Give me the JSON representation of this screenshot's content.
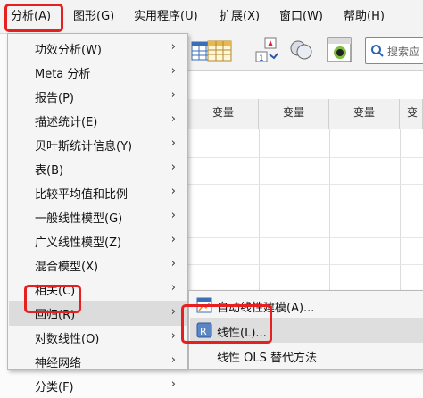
{
  "menubar": {
    "items": [
      {
        "label": "分析(A)"
      },
      {
        "label": "图形(G)"
      },
      {
        "label": "实用程序(U)"
      },
      {
        "label": "扩展(X)"
      },
      {
        "label": "窗口(W)"
      },
      {
        "label": "帮助(H)"
      }
    ]
  },
  "toolbar": {
    "search_placeholder": "搜索应"
  },
  "grid": {
    "headers": [
      "变量",
      "变量",
      "变量",
      "变量"
    ]
  },
  "analyze_menu": {
    "items": [
      {
        "label": "功效分析(W)"
      },
      {
        "label": "Meta 分析"
      },
      {
        "label": "报告(P)"
      },
      {
        "label": "描述统计(E)"
      },
      {
        "label": "贝叶斯统计信息(Y)"
      },
      {
        "label": "表(B)"
      },
      {
        "label": "比较平均值和比例"
      },
      {
        "label": "一般线性模型(G)"
      },
      {
        "label": "广义线性模型(Z)"
      },
      {
        "label": "混合模型(X)"
      },
      {
        "label": "相关(C)"
      },
      {
        "label": "回归(R)"
      },
      {
        "label": "对数线性(O)"
      },
      {
        "label": "神经网络"
      },
      {
        "label": "分类(F)"
      }
    ],
    "arrow": "›"
  },
  "regression_submenu": {
    "items": [
      {
        "label": "自动线性建模(A)..."
      },
      {
        "label": "线性(L)..."
      },
      {
        "label": "线性 OLS 替代方法"
      }
    ]
  },
  "colors": {
    "highlight_box": "#e62020",
    "menu_bg": "#f5f5f5",
    "hover_bg": "#dcdcdc"
  }
}
